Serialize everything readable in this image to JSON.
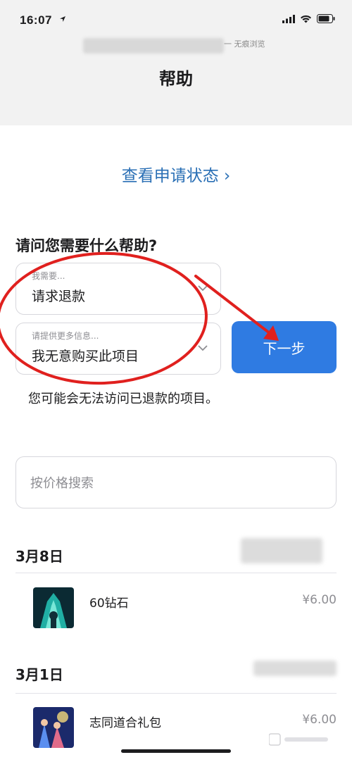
{
  "status_bar": {
    "time": "16:07"
  },
  "header": {
    "browser_hint": "一 无痕浏览",
    "title": "帮助"
  },
  "links": {
    "view_status": "查看申请状态 ›"
  },
  "form": {
    "question": "请问您需要什么帮助?",
    "need_select": {
      "hint": "我需要...",
      "value": "请求退款"
    },
    "info_select": {
      "hint": "请提供更多信息...",
      "value": "我无意购买此项目"
    },
    "next_label": "下一步",
    "notice": "您可能会无法访问已退款的项目。"
  },
  "search": {
    "placeholder": "按价格搜索"
  },
  "purchases": [
    {
      "date": "3月8日",
      "item": {
        "name": "60钻石",
        "price": "¥6.00",
        "icon": "game-thumbnail-cyan"
      }
    },
    {
      "date": "3月1日",
      "item": {
        "name": "志同道合礼包",
        "price": "¥6.00",
        "icon": "game-thumbnail-blue"
      }
    }
  ],
  "colors": {
    "accent": "#2f7be2",
    "link": "#2a6fb5",
    "annotation_red": "#e0201e"
  }
}
